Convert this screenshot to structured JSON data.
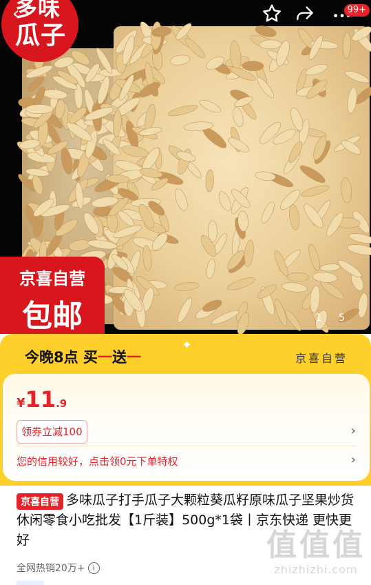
{
  "hero": {
    "badge_line1": "多味",
    "badge_line2": "瓜子",
    "jx_badge_line1": "京喜自营",
    "jx_badge_line2": "包邮",
    "pager": "1 5",
    "cart_count": "99+"
  },
  "icons": {
    "back": "back-icon",
    "favorite": "star-icon",
    "share": "share-icon",
    "more": "more-icon",
    "info": "info-icon"
  },
  "promo": {
    "title_prefix": "今晚8点 买",
    "title_mid": "一",
    "title_suffix": "送",
    "title_end": "一",
    "right_label": "京喜自营"
  },
  "price": {
    "currency": "¥",
    "integer": "11",
    "decimal": ".9"
  },
  "coupon": {
    "label": "领券立减100"
  },
  "credit": {
    "text": "您的信用较好，点击领0元下单特权"
  },
  "product": {
    "tag": "京喜自营",
    "title": "多味瓜子打手瓜子大颗粒葵瓜籽原味瓜子坚果炒货休闲零食小吃批发【1斤装】500g*1袋丨京东快递 更快更好",
    "sales": "全网热销20万+"
  },
  "watermark": {
    "line1": "值值值",
    "line2": "zhizhizhi.com"
  },
  "colors": {
    "accent": "#e4242b",
    "promo_yellow": "#ffcf2b"
  }
}
